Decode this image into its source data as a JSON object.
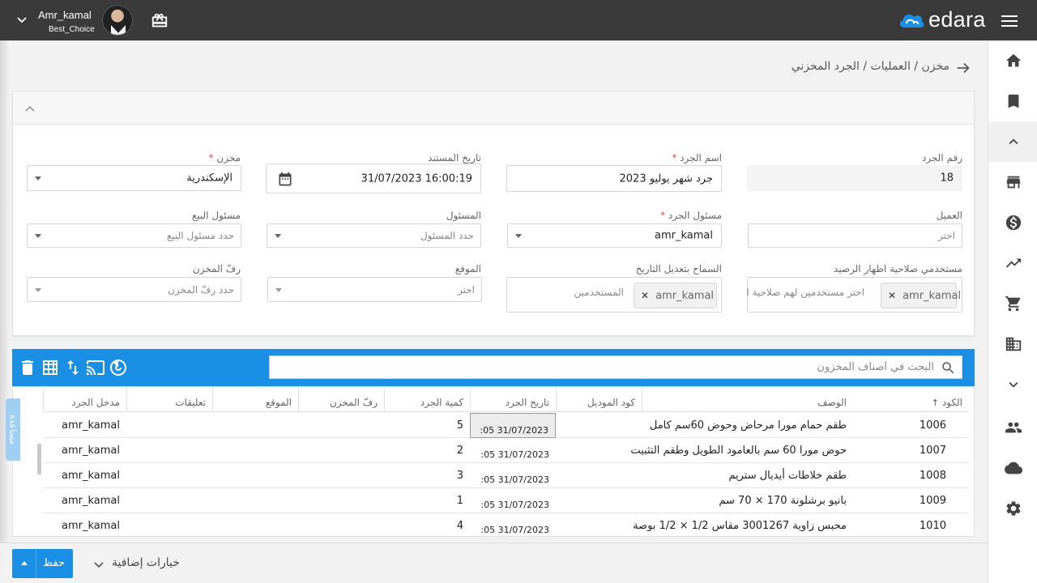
{
  "user": {
    "name": "Amr_kamal",
    "subtitle": "Best_Choice"
  },
  "brand": {
    "logo_text": "edara",
    "accent": "#1a8fe3"
  },
  "breadcrumb": "مخزن / العمليات / الجرد المخزني",
  "form": {
    "count_number": {
      "label": "رقم الجرد",
      "value": "18"
    },
    "count_name": {
      "label": "اسم الجرد",
      "required": "*",
      "value": "جرد شهر يوليو 2023"
    },
    "doc_date": {
      "label": "تاريخ المستند",
      "value": "31/07/2023 16:00:19"
    },
    "warehouse": {
      "label": "مخزن",
      "required": "*",
      "value": "الإسكندرية"
    },
    "customer": {
      "label": "العميل",
      "placeholder": "اختر"
    },
    "count_manager": {
      "label": "مسئول الجرد",
      "required": "*",
      "value": "amr_kamal"
    },
    "responsible": {
      "label": "المسئول",
      "placeholder": "حدد المسئول"
    },
    "sales_manager": {
      "label": "مسئول البيع",
      "placeholder": "حدد مسئول البيع"
    },
    "balance_users": {
      "label": "مستخدمي صلاحية اظهار الرصيد",
      "chip": "amr_kamal",
      "placeholder": "اختر مستخدمين لهم صلاحية ا"
    },
    "date_edit": {
      "label": "السماح بتعديل التاريخ",
      "chip": "amr_kamal",
      "placeholder": "المستخدمين"
    },
    "location": {
      "label": "الموقع",
      "placeholder": "اختر"
    },
    "shelf": {
      "label": "رفّ المخزن",
      "placeholder": "حدد رفّ المخزن"
    }
  },
  "search": {
    "placeholder": "البحث في أصناف المخزون"
  },
  "help_tab": "مساعدة",
  "table": {
    "headers": {
      "code": "الكود",
      "desc": "الوصف",
      "model": "كود الموديل",
      "date": "تاريخ الجرد",
      "qty": "كمية الجرد",
      "shelf": "رفّ المخزن",
      "location": "الموقع",
      "notes": "تعليقات",
      "entered_by": "مدخل الجرد"
    },
    "rows": [
      {
        "code": "1006",
        "desc": "طقم حمام مورا مرحاض وحوض 60سم كامل",
        "date": "31/07/2023 05:",
        "qty": "5",
        "entered_by": "amr_kamal"
      },
      {
        "code": "1007",
        "desc": "حوض مورا 60 سم بالعامود الطويل وطقم التثبيت",
        "date": "31/07/2023 05:",
        "qty": "2",
        "entered_by": "amr_kamal"
      },
      {
        "code": "1008",
        "desc": "طقم خلاطات أيديال ستريم",
        "date": "31/07/2023 05:",
        "qty": "3",
        "entered_by": "amr_kamal"
      },
      {
        "code": "1009",
        "desc": "بانيو برشلونة 170 × 70 سم",
        "date": "31/07/2023 05:",
        "qty": "1",
        "entered_by": "amr_kamal"
      },
      {
        "code": "1010",
        "desc": "محبس زاوية 3001267 مقاس 1/2 × 1/2 بوصة",
        "date": "31/07/2023 05:",
        "qty": "4",
        "entered_by": "amr_kamal"
      }
    ]
  },
  "footer": {
    "save_label": "حفظ",
    "extra_options": "خيارات إضافية"
  }
}
